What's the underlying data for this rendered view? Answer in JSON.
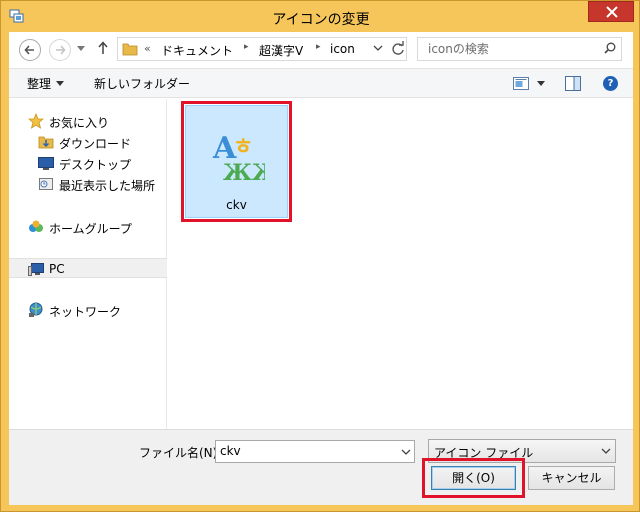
{
  "window": {
    "title": "アイコンの変更"
  },
  "address": {
    "overflow": "«",
    "crumbs": [
      "ドキュメント",
      "超漢字V",
      "icon"
    ]
  },
  "search": {
    "placeholder": "iconの検索"
  },
  "toolbar": {
    "organize_label": "整理",
    "new_folder_label": "新しいフォルダー"
  },
  "navpane": {
    "favorites": [
      {
        "label": "お気に入り",
        "icon": "star-icon"
      },
      {
        "label": "ダウンロード",
        "icon": "downloads-icon"
      },
      {
        "label": "デスクトップ",
        "icon": "desktop-icon"
      },
      {
        "label": "最近表示した場所",
        "icon": "recent-places-icon"
      }
    ],
    "homegroup": {
      "label": "ホームグループ",
      "icon": "homegroup-icon"
    },
    "pc": {
      "label": "PC",
      "icon": "pc-icon"
    },
    "network": {
      "label": "ネットワーク",
      "icon": "network-icon"
    }
  },
  "files": [
    {
      "name": "ckv",
      "icon": "ckv-app-icon",
      "selected": true,
      "thumb_text": "Aㅎ ЖЖ"
    }
  ],
  "bottom": {
    "filename_label": "ファイル名(N):",
    "filename_value": "ckv",
    "filetype_value": "アイコン ファイル",
    "open_label": "開く(O)",
    "cancel_label": "キャンセル"
  },
  "colors": {
    "title_bar": "#f6c65b",
    "close_button": "#c7362c",
    "selection_fill": "#cce8ff",
    "highlight_box": "#e0132a"
  }
}
